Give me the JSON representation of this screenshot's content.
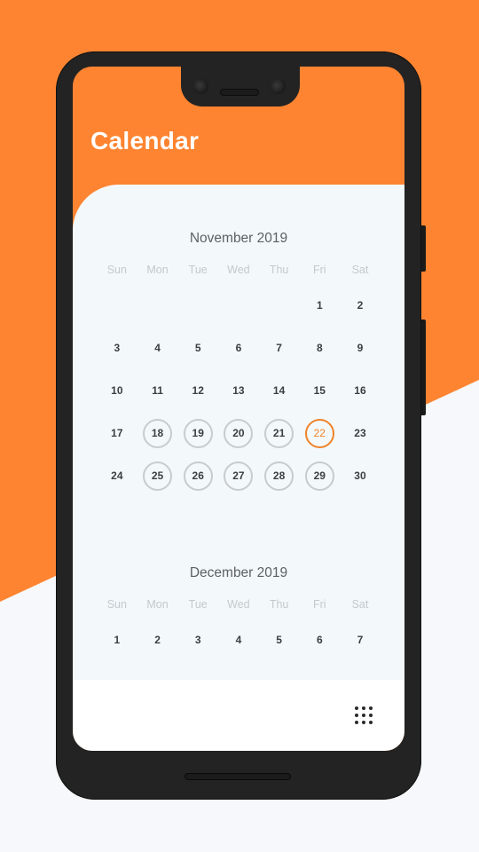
{
  "app": {
    "title": "Calendar"
  },
  "colors": {
    "accent": "#fe8431",
    "today_ring": "#f08328",
    "ring": "#c8cbcf",
    "panel": "#f3f8fb"
  },
  "weekdays": [
    "Sun",
    "Mon",
    "Tue",
    "Wed",
    "Thu",
    "Fri",
    "Sat"
  ],
  "months": [
    {
      "title": "November 2019",
      "weeks": [
        [
          "",
          "",
          "",
          "",
          "",
          "1",
          "2"
        ],
        [
          "3",
          "4",
          "5",
          "6",
          "7",
          "8",
          "9"
        ],
        [
          "10",
          "11",
          "12",
          "13",
          "14",
          "15",
          "16"
        ],
        [
          "17",
          "18",
          "19",
          "20",
          "21",
          "22",
          "23"
        ],
        [
          "24",
          "25",
          "26",
          "27",
          "28",
          "29",
          "30"
        ]
      ],
      "ringed_days": [
        "18",
        "19",
        "20",
        "21",
        "25",
        "26",
        "27",
        "28",
        "29"
      ],
      "today": "22"
    },
    {
      "title": "December 2019",
      "weeks": [
        [
          "1",
          "2",
          "3",
          "4",
          "5",
          "6",
          "7"
        ]
      ],
      "ringed_days": [],
      "today": ""
    }
  ],
  "bottom_bar": {
    "menu_icon": "grid-dots-icon"
  }
}
